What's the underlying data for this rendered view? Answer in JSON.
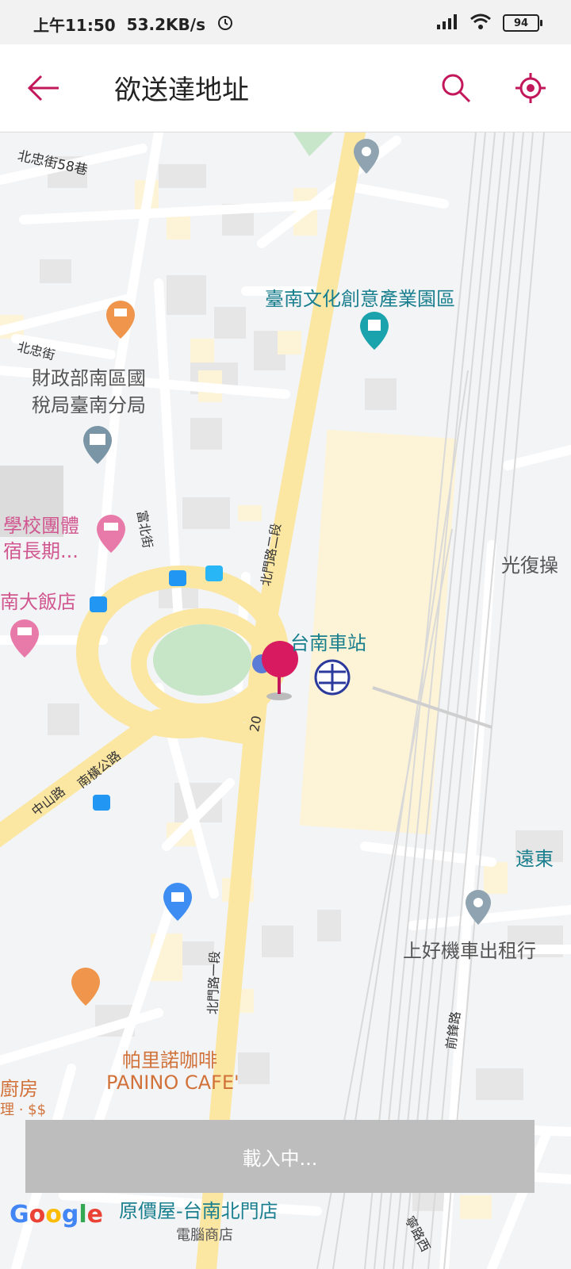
{
  "status_bar": {
    "time": "上午11:50",
    "speed": "53.2KB/s",
    "battery": "94"
  },
  "header": {
    "title": "欲送達地址"
  },
  "map": {
    "labels": {
      "beizhong_lane": "北忠街58巷",
      "beizhong": "北忠街",
      "creative_park": "臺南文化創意產業園區",
      "tax_bureau_1": "財政部南區國",
      "tax_bureau_2": "稅局臺南分局",
      "school_1": "學校團體",
      "school_2": "宿長期...",
      "fubei": "富北街",
      "beimen2": "北門路二段",
      "beimen1": "北門路一段",
      "hotel": "南大飯店",
      "station": "台南車站",
      "num20": "20",
      "zhongshan": "中山路",
      "nanheng": "南橫公路",
      "guangfu": "光復操",
      "yuandong": "遠東",
      "motor": "上好機車出租行",
      "qianfeng": "前鋒路",
      "cafe_1": "帕里諾咖啡",
      "cafe_2": "PANINO CAFE'",
      "kitchen_1": "廚房",
      "kitchen_2": "理 · $$",
      "bottom_store": "原價屋-台南北門店",
      "bottom_sub": "電腦商店",
      "bottom_road": "寧路西"
    }
  },
  "loading": {
    "text": "載入中..."
  },
  "google": {
    "logo": "Google"
  },
  "colors": {
    "accent": "#c2185b",
    "road_major": "#fbe6a2",
    "poi_blue": "#1a7f8e"
  }
}
